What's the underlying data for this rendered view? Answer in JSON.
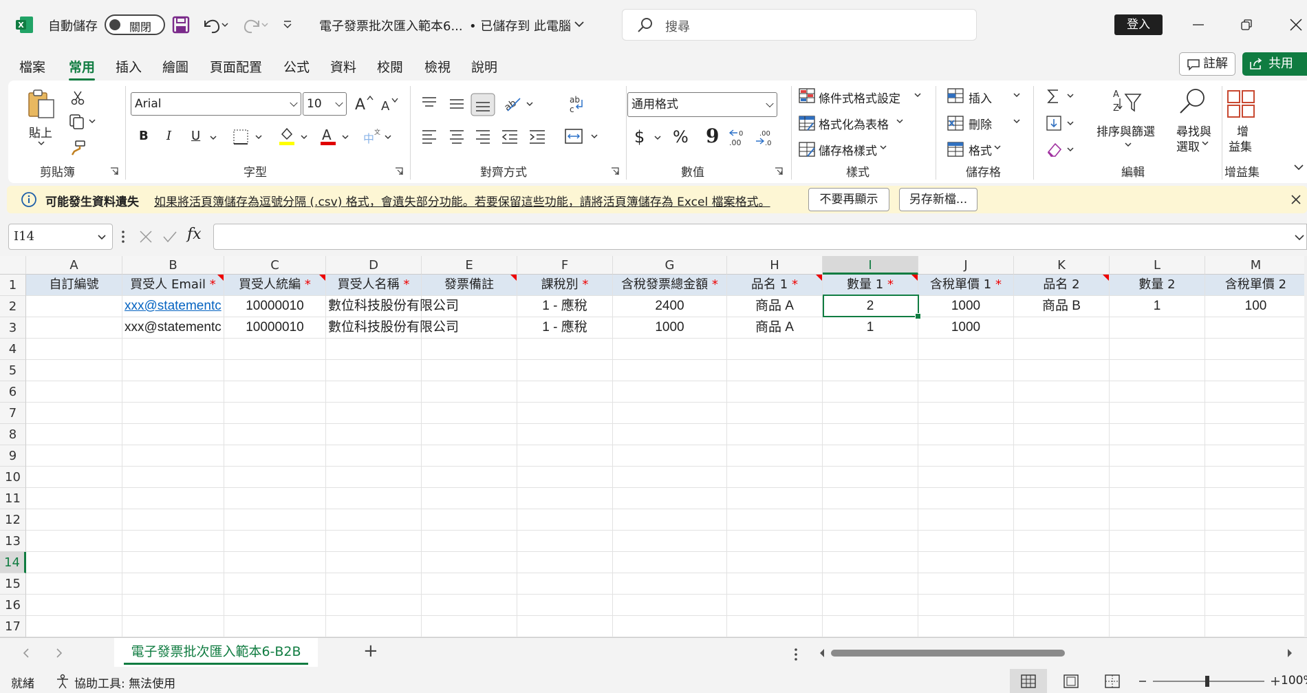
{
  "titlebar": {
    "autosave_label": "自動儲存",
    "autosave_state": "關閉",
    "file_name": "電子發票批次匯入範本6...",
    "save_status": "• 已儲存到 此電腦",
    "search_placeholder": "搜尋",
    "login": "登入"
  },
  "menu": {
    "tabs": [
      "檔案",
      "常用",
      "插入",
      "繪圖",
      "頁面配置",
      "公式",
      "資料",
      "校閱",
      "檢視",
      "說明"
    ],
    "active": "常用",
    "comment": "註解",
    "share": "共用"
  },
  "ribbon": {
    "clipboard": {
      "paste": "貼上",
      "label": "剪貼簿"
    },
    "font": {
      "name": "Arial",
      "size": "10",
      "label": "字型",
      "bold": "B",
      "italic": "I",
      "underline": "U"
    },
    "alignment": {
      "label": "對齊方式"
    },
    "number": {
      "format": "通用格式",
      "label": "數值",
      "currency": "$",
      "percent": "%",
      "comma": "9"
    },
    "styles": {
      "conditional": "條件式格式設定",
      "table": "格式化為表格",
      "cell_styles": "儲存格樣式",
      "label": "樣式"
    },
    "cells": {
      "insert": "插入",
      "delete": "刪除",
      "format": "格式",
      "label": "儲存格"
    },
    "editing": {
      "sort": "排序與篩選",
      "find_1": "尋找與",
      "find_2": "選取",
      "label": "編輯"
    },
    "addins": {
      "add_1": "增",
      "add_2": "益集",
      "label": "增益集"
    }
  },
  "infobar": {
    "title": "可能發生資料遺失",
    "message": "如果將活頁簿儲存為逗號分隔 (.csv) 格式，會遺失部分功能。若要保留這些功能，請將活頁簿儲存為 Excel 檔案格式。",
    "dont_show": "不要再顯示",
    "save_as": "另存新檔..."
  },
  "formula_bar": {
    "name_box": "I14",
    "fx": "fx",
    "value": ""
  },
  "sheet": {
    "columns": [
      "A",
      "B",
      "C",
      "D",
      "E",
      "F",
      "G",
      "H",
      "I",
      "J",
      "K",
      "L",
      "M"
    ],
    "selected_column": "I",
    "rows": [
      "1",
      "2",
      "3",
      "4",
      "5",
      "6",
      "7",
      "8",
      "9",
      "10",
      "11",
      "12",
      "13",
      "14",
      "15",
      "16",
      "17"
    ],
    "selected_row": "14",
    "header_row": [
      {
        "text": "自訂編號",
        "required": false
      },
      {
        "text": "買受人 Email",
        "required": true
      },
      {
        "text": "買受人統編",
        "required": true
      },
      {
        "text": "買受人名稱",
        "required": true
      },
      {
        "text": "發票備註",
        "required": false
      },
      {
        "text": "課稅別",
        "required": true
      },
      {
        "text": "含稅發票總金額",
        "required": true
      },
      {
        "text": "品名 1",
        "required": true
      },
      {
        "text": "數量 1",
        "required": true
      },
      {
        "text": "含稅單價 1",
        "required": true
      },
      {
        "text": "品名 2",
        "required": false
      },
      {
        "text": "數量 2",
        "required": false
      },
      {
        "text": "含稅單價 2",
        "required": false
      }
    ],
    "required_marker": "*",
    "data_rows": [
      [
        "",
        "xxx@statementc",
        "10000010",
        "數位科技股份有限公司",
        "",
        "1 - 應稅",
        "2400",
        "商品 A",
        "2",
        "1000",
        "商品 B",
        "1",
        "100"
      ],
      [
        "",
        "xxx@statementc",
        "10000010",
        "數位科技股份有限公司",
        "",
        "1 - 應稅",
        "1000",
        "商品 A",
        "1",
        "1000",
        "",
        "",
        ""
      ]
    ]
  },
  "sheet_tabs": {
    "active": "電子發票批次匯入範本6-B2B",
    "add": "+"
  },
  "status": {
    "ready": "就緒",
    "accessibility": "協助工具: 無法使用",
    "zoom": "100%"
  },
  "colors": {
    "excel_green": "#107c41",
    "header_fill": "#dce6f1",
    "info_bg": "#fdf6d4",
    "link": "#0563c1",
    "required": "#e00000"
  }
}
